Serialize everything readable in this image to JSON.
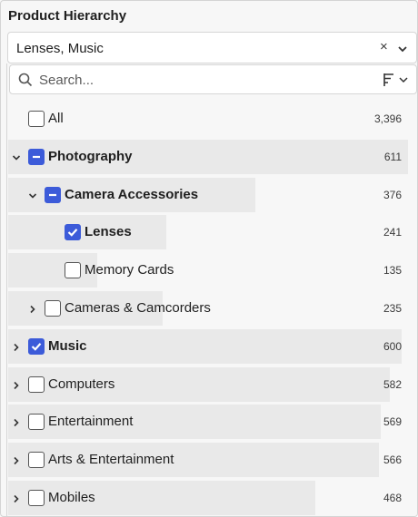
{
  "header": {
    "title": "Product Hierarchy"
  },
  "select": {
    "value": "Lenses, Music",
    "clear_icon": "close-icon",
    "dropdown_icon": "chevron-down-icon"
  },
  "search": {
    "placeholder": "Search...",
    "value": "",
    "icon": "search-icon",
    "sort_icon": "sort-icon"
  },
  "colors": {
    "accent": "#3c5bd9",
    "bar": "#e9e9e9"
  },
  "tree": {
    "items": [
      {
        "label": "All",
        "count": "3,396",
        "state": "unchecked",
        "bold": false,
        "expander": "none",
        "depth": 0,
        "bar_fraction": 0
      },
      {
        "label": "Photography",
        "count": "611",
        "state": "partial",
        "bold": true,
        "expander": "expanded",
        "depth": 0,
        "bar_fraction": 0.18
      },
      {
        "label": "Camera Accessories",
        "count": "376",
        "state": "partial",
        "bold": true,
        "expander": "expanded",
        "depth": 1,
        "bar_fraction": 0.11
      },
      {
        "label": "Lenses",
        "count": "241",
        "state": "checked",
        "bold": true,
        "expander": "none",
        "depth": 2,
        "bar_fraction": 0.071
      },
      {
        "label": "Memory Cards",
        "count": "135",
        "state": "unchecked",
        "bold": false,
        "expander": "none",
        "depth": 2,
        "bar_fraction": 0.04
      },
      {
        "label": "Cameras & Camcorders",
        "count": "235",
        "state": "unchecked",
        "bold": false,
        "expander": "collapsed",
        "depth": 1,
        "bar_fraction": 0.069
      },
      {
        "label": "Music",
        "count": "600",
        "state": "checked",
        "bold": true,
        "expander": "collapsed",
        "depth": 0,
        "bar_fraction": 0.177
      },
      {
        "label": "Computers",
        "count": "582",
        "state": "unchecked",
        "bold": false,
        "expander": "collapsed",
        "depth": 0,
        "bar_fraction": 0.171
      },
      {
        "label": "Entertainment",
        "count": "569",
        "state": "unchecked",
        "bold": false,
        "expander": "collapsed",
        "depth": 0,
        "bar_fraction": 0.168
      },
      {
        "label": "Arts & Entertainment",
        "count": "566",
        "state": "unchecked",
        "bold": false,
        "expander": "collapsed",
        "depth": 0,
        "bar_fraction": 0.167
      },
      {
        "label": "Mobiles",
        "count": "468",
        "state": "unchecked",
        "bold": false,
        "expander": "collapsed",
        "depth": 0,
        "bar_fraction": 0.138
      }
    ]
  }
}
